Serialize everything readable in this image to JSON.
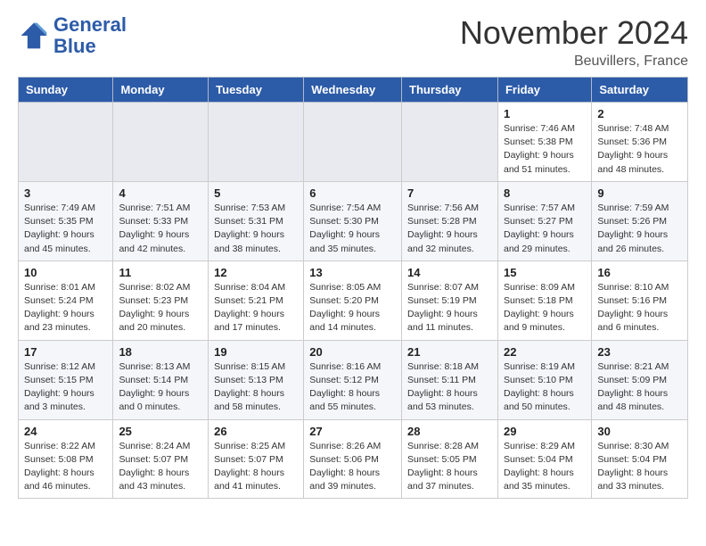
{
  "header": {
    "logo_line1": "General",
    "logo_line2": "Blue",
    "month_title": "November 2024",
    "location": "Beuvillers, France"
  },
  "weekdays": [
    "Sunday",
    "Monday",
    "Tuesday",
    "Wednesday",
    "Thursday",
    "Friday",
    "Saturday"
  ],
  "weeks": [
    [
      {
        "day": "",
        "sunrise": "",
        "sunset": "",
        "daylight": ""
      },
      {
        "day": "",
        "sunrise": "",
        "sunset": "",
        "daylight": ""
      },
      {
        "day": "",
        "sunrise": "",
        "sunset": "",
        "daylight": ""
      },
      {
        "day": "",
        "sunrise": "",
        "sunset": "",
        "daylight": ""
      },
      {
        "day": "",
        "sunrise": "",
        "sunset": "",
        "daylight": ""
      },
      {
        "day": "1",
        "sunrise": "Sunrise: 7:46 AM",
        "sunset": "Sunset: 5:38 PM",
        "daylight": "Daylight: 9 hours and 51 minutes."
      },
      {
        "day": "2",
        "sunrise": "Sunrise: 7:48 AM",
        "sunset": "Sunset: 5:36 PM",
        "daylight": "Daylight: 9 hours and 48 minutes."
      }
    ],
    [
      {
        "day": "3",
        "sunrise": "Sunrise: 7:49 AM",
        "sunset": "Sunset: 5:35 PM",
        "daylight": "Daylight: 9 hours and 45 minutes."
      },
      {
        "day": "4",
        "sunrise": "Sunrise: 7:51 AM",
        "sunset": "Sunset: 5:33 PM",
        "daylight": "Daylight: 9 hours and 42 minutes."
      },
      {
        "day": "5",
        "sunrise": "Sunrise: 7:53 AM",
        "sunset": "Sunset: 5:31 PM",
        "daylight": "Daylight: 9 hours and 38 minutes."
      },
      {
        "day": "6",
        "sunrise": "Sunrise: 7:54 AM",
        "sunset": "Sunset: 5:30 PM",
        "daylight": "Daylight: 9 hours and 35 minutes."
      },
      {
        "day": "7",
        "sunrise": "Sunrise: 7:56 AM",
        "sunset": "Sunset: 5:28 PM",
        "daylight": "Daylight: 9 hours and 32 minutes."
      },
      {
        "day": "8",
        "sunrise": "Sunrise: 7:57 AM",
        "sunset": "Sunset: 5:27 PM",
        "daylight": "Daylight: 9 hours and 29 minutes."
      },
      {
        "day": "9",
        "sunrise": "Sunrise: 7:59 AM",
        "sunset": "Sunset: 5:26 PM",
        "daylight": "Daylight: 9 hours and 26 minutes."
      }
    ],
    [
      {
        "day": "10",
        "sunrise": "Sunrise: 8:01 AM",
        "sunset": "Sunset: 5:24 PM",
        "daylight": "Daylight: 9 hours and 23 minutes."
      },
      {
        "day": "11",
        "sunrise": "Sunrise: 8:02 AM",
        "sunset": "Sunset: 5:23 PM",
        "daylight": "Daylight: 9 hours and 20 minutes."
      },
      {
        "day": "12",
        "sunrise": "Sunrise: 8:04 AM",
        "sunset": "Sunset: 5:21 PM",
        "daylight": "Daylight: 9 hours and 17 minutes."
      },
      {
        "day": "13",
        "sunrise": "Sunrise: 8:05 AM",
        "sunset": "Sunset: 5:20 PM",
        "daylight": "Daylight: 9 hours and 14 minutes."
      },
      {
        "day": "14",
        "sunrise": "Sunrise: 8:07 AM",
        "sunset": "Sunset: 5:19 PM",
        "daylight": "Daylight: 9 hours and 11 minutes."
      },
      {
        "day": "15",
        "sunrise": "Sunrise: 8:09 AM",
        "sunset": "Sunset: 5:18 PM",
        "daylight": "Daylight: 9 hours and 9 minutes."
      },
      {
        "day": "16",
        "sunrise": "Sunrise: 8:10 AM",
        "sunset": "Sunset: 5:16 PM",
        "daylight": "Daylight: 9 hours and 6 minutes."
      }
    ],
    [
      {
        "day": "17",
        "sunrise": "Sunrise: 8:12 AM",
        "sunset": "Sunset: 5:15 PM",
        "daylight": "Daylight: 9 hours and 3 minutes."
      },
      {
        "day": "18",
        "sunrise": "Sunrise: 8:13 AM",
        "sunset": "Sunset: 5:14 PM",
        "daylight": "Daylight: 9 hours and 0 minutes."
      },
      {
        "day": "19",
        "sunrise": "Sunrise: 8:15 AM",
        "sunset": "Sunset: 5:13 PM",
        "daylight": "Daylight: 8 hours and 58 minutes."
      },
      {
        "day": "20",
        "sunrise": "Sunrise: 8:16 AM",
        "sunset": "Sunset: 5:12 PM",
        "daylight": "Daylight: 8 hours and 55 minutes."
      },
      {
        "day": "21",
        "sunrise": "Sunrise: 8:18 AM",
        "sunset": "Sunset: 5:11 PM",
        "daylight": "Daylight: 8 hours and 53 minutes."
      },
      {
        "day": "22",
        "sunrise": "Sunrise: 8:19 AM",
        "sunset": "Sunset: 5:10 PM",
        "daylight": "Daylight: 8 hours and 50 minutes."
      },
      {
        "day": "23",
        "sunrise": "Sunrise: 8:21 AM",
        "sunset": "Sunset: 5:09 PM",
        "daylight": "Daylight: 8 hours and 48 minutes."
      }
    ],
    [
      {
        "day": "24",
        "sunrise": "Sunrise: 8:22 AM",
        "sunset": "Sunset: 5:08 PM",
        "daylight": "Daylight: 8 hours and 46 minutes."
      },
      {
        "day": "25",
        "sunrise": "Sunrise: 8:24 AM",
        "sunset": "Sunset: 5:07 PM",
        "daylight": "Daylight: 8 hours and 43 minutes."
      },
      {
        "day": "26",
        "sunrise": "Sunrise: 8:25 AM",
        "sunset": "Sunset: 5:07 PM",
        "daylight": "Daylight: 8 hours and 41 minutes."
      },
      {
        "day": "27",
        "sunrise": "Sunrise: 8:26 AM",
        "sunset": "Sunset: 5:06 PM",
        "daylight": "Daylight: 8 hours and 39 minutes."
      },
      {
        "day": "28",
        "sunrise": "Sunrise: 8:28 AM",
        "sunset": "Sunset: 5:05 PM",
        "daylight": "Daylight: 8 hours and 37 minutes."
      },
      {
        "day": "29",
        "sunrise": "Sunrise: 8:29 AM",
        "sunset": "Sunset: 5:04 PM",
        "daylight": "Daylight: 8 hours and 35 minutes."
      },
      {
        "day": "30",
        "sunrise": "Sunrise: 8:30 AM",
        "sunset": "Sunset: 5:04 PM",
        "daylight": "Daylight: 8 hours and 33 minutes."
      }
    ]
  ]
}
